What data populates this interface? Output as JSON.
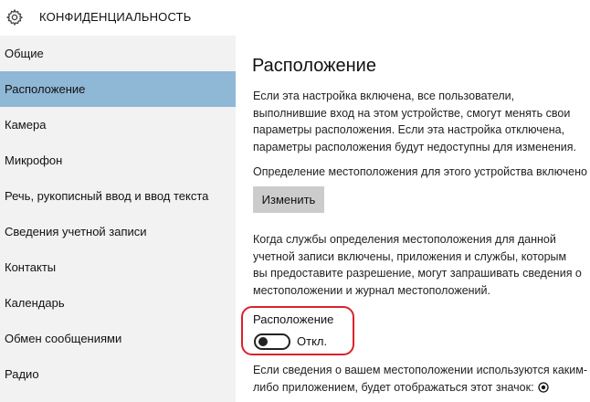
{
  "header": {
    "icon": "gear-icon",
    "title": "КОНФИДЕНЦИАЛЬНОСТЬ"
  },
  "sidebar": {
    "items": [
      {
        "label": "Общие"
      },
      {
        "label": "Расположение",
        "active": true
      },
      {
        "label": "Камера"
      },
      {
        "label": "Микрофон"
      },
      {
        "label": "Речь, рукописный ввод и ввод текста"
      },
      {
        "label": "Сведения учетной записи"
      },
      {
        "label": "Контакты"
      },
      {
        "label": "Календарь"
      },
      {
        "label": "Обмен сообщениями"
      },
      {
        "label": "Радио"
      }
    ]
  },
  "main": {
    "title": "Расположение",
    "desc1": "Если эта настройка включена, все пользователи, выполнившие вход на этом устройстве, смогут менять свои параметры расположения. Если эта настройка отключена, параметры расположения будут недоступны для изменения.",
    "status": "Определение местоположения для этого устройства включено",
    "change_button": "Изменить",
    "desc2": "Когда службы определения местоположения для данной учетной записи включены, приложения и службы, которым вы предоставите разрешение, могут запрашивать сведения о местоположении и журнал местоположений.",
    "toggle": {
      "label": "Расположение",
      "state": "Откл.",
      "on": false
    },
    "desc3": "Если сведения о вашем местоположении используются каким-либо приложением, будет отображаться этот значок:",
    "desc3_icon": "location-indicator-icon"
  },
  "colors": {
    "sidebar_bg": "#f2f2f2",
    "active_item": "#8fb7d6",
    "button_bg": "#cccccc",
    "highlight": "#d9232d"
  }
}
